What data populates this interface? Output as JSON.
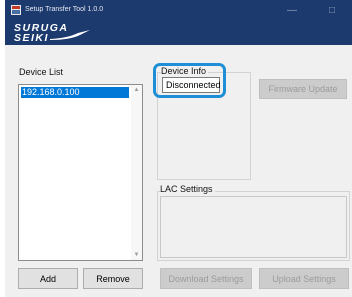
{
  "window": {
    "title": "Setup Transfer Tool 1.0.0",
    "minimize_glyph": "—",
    "maximize_glyph": "□"
  },
  "banner": {
    "logo_line1": "SURUGA",
    "logo_line2": "SEIKI"
  },
  "device_list": {
    "label": "Device List",
    "items": [
      "192.168.0.100"
    ],
    "selected_index": 0,
    "add_label": "Add",
    "remove_label": "Remove"
  },
  "device_info": {
    "label": "Device Info",
    "status": "Disconnected",
    "firmware_update_label": "Firmware Update"
  },
  "lac_settings": {
    "label": "LAC Settings",
    "download_label": "Download Settings",
    "upload_label": "Upload Settings"
  },
  "colors": {
    "titlebar": "#1d3a6e",
    "selection": "#0078d7",
    "highlight": "#1e8fd6"
  }
}
